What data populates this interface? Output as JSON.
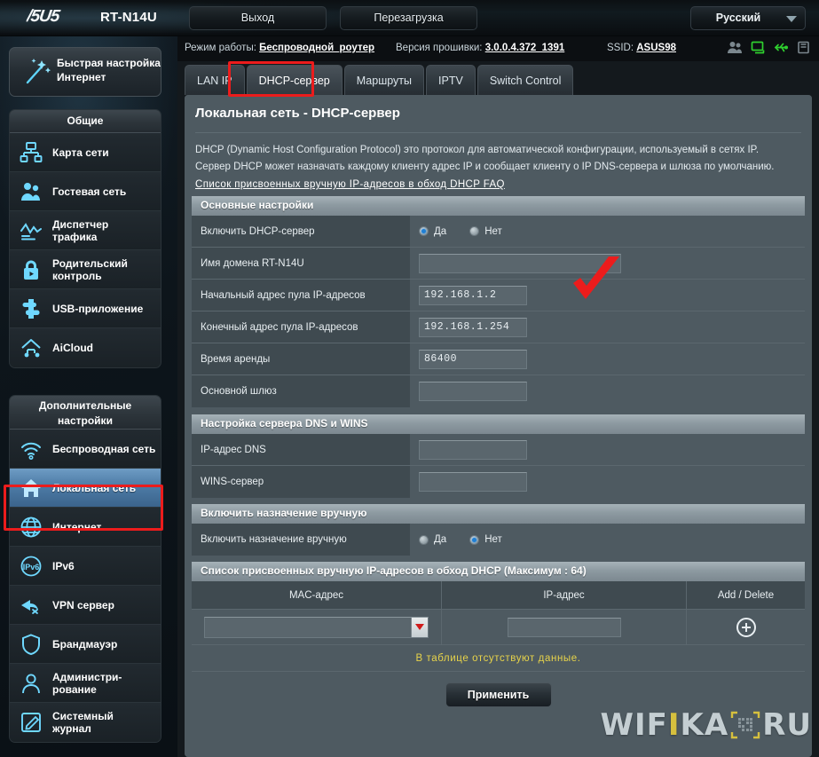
{
  "topbar": {
    "brand": "/5U5",
    "model": "RT-N14U",
    "logout_label": "Выход",
    "reboot_label": "Перезагрузка",
    "language": "Русский",
    "caret_icon": "chevron-down-icon"
  },
  "statusline": {
    "mode_label": "Режим работы:",
    "mode_value": "Беспроводной_роутер",
    "firmware_label": "Версия прошивки:",
    "firmware_value": "3.0.0.4.372_1391",
    "ssid_label": "SSID:",
    "ssid_value": "ASUS98",
    "icons": [
      {
        "name": "users-icon",
        "color": "#7b878e"
      },
      {
        "name": "lan-monitor-icon",
        "color": "#2fd02f"
      },
      {
        "name": "usb-icon",
        "color": "#2fd02f"
      },
      {
        "name": "printer-icon",
        "color": "#7b878e"
      }
    ]
  },
  "quick_setup": {
    "line1": "Быстрая настройка",
    "line2": "Интернет",
    "icon": "magic-wand-icon"
  },
  "sidebar": {
    "groups": [
      {
        "title": "Общие",
        "items": [
          {
            "label": "Карта сети",
            "icon": "network-map-icon",
            "active": false
          },
          {
            "label": "Гостевая сеть",
            "icon": "guest-network-icon",
            "active": false
          },
          {
            "label": "Диспетчер трафика",
            "icon": "traffic-manager-icon",
            "active": false
          },
          {
            "label": "Родительский контроль",
            "icon": "parental-lock-icon",
            "active": false
          },
          {
            "label": "USB-приложение",
            "icon": "usb-application-icon",
            "active": false
          },
          {
            "label": "AiCloud",
            "icon": "aicloud-icon",
            "active": false
          }
        ]
      },
      {
        "title": "Дополнительные настройки",
        "items": [
          {
            "label": "Беспроводная сеть",
            "icon": "wifi-icon",
            "active": false
          },
          {
            "label": "Локальная сеть",
            "icon": "home-lan-icon",
            "active": true
          },
          {
            "label": "Интернет",
            "icon": "globe-icon",
            "active": false
          },
          {
            "label": "IPv6",
            "icon": "ipv6-icon",
            "active": false
          },
          {
            "label": "VPN сервер",
            "icon": "vpn-icon",
            "active": false
          },
          {
            "label": "Брандмауэр",
            "icon": "shield-icon",
            "active": false
          },
          {
            "label": "Администри-рование",
            "icon": "admin-user-icon",
            "active": false
          },
          {
            "label": "Системный журнал",
            "icon": "system-log-icon",
            "active": false
          }
        ]
      }
    ]
  },
  "tabs": [
    {
      "label": "LAN IP",
      "selected": false
    },
    {
      "label": "DHCP-сервер",
      "selected": true
    },
    {
      "label": "Маршруты",
      "selected": false
    },
    {
      "label": "IPTV",
      "selected": false
    },
    {
      "label": "Switch Control",
      "selected": false
    }
  ],
  "page": {
    "title": "Локальная сеть - DHCP-сервер",
    "desc_line1": "DHCP (Dynamic Host Configuration Protocol) это протокол для автоматической конфигурации, используемый в сетях IP.",
    "desc_line2": "Сервер DHCP может назначать каждому клиенту адрес IP и сообщает клиенту о IP DNS-сервера и шлюза по умолчанию.",
    "faq_link": "Список присвоенных вручную IP-адресов в обход DHCP FAQ"
  },
  "sections": {
    "basic": {
      "title": "Основные настройки",
      "rows": [
        {
          "label": "Включить DHCP-сервер",
          "type": "radio",
          "yes_label": "Да",
          "no_label": "Нет",
          "value": "yes"
        },
        {
          "label": "Имя домена RT-N14U",
          "type": "input",
          "value": "",
          "width": "wide"
        },
        {
          "label": "Начальный адрес пула IP-адресов",
          "type": "input",
          "value": "192.168.1.2",
          "width": "med"
        },
        {
          "label": "Конечный адрес пула IP-адресов",
          "type": "input",
          "value": "192.168.1.254",
          "width": "med"
        },
        {
          "label": "Время аренды",
          "type": "input",
          "value": "86400",
          "width": "med"
        },
        {
          "label": "Основной шлюз",
          "type": "input",
          "value": "",
          "width": "med"
        }
      ]
    },
    "dns": {
      "title": "Настройка сервера DNS и WINS",
      "rows": [
        {
          "label": "IP-адрес DNS",
          "type": "input",
          "value": "",
          "width": "med"
        },
        {
          "label": "WINS-сервер",
          "type": "input",
          "value": "",
          "width": "med"
        }
      ]
    },
    "manual": {
      "title": "Включить назначение вручную",
      "rows": [
        {
          "label": "Включить назначение вручную",
          "type": "radio",
          "yes_label": "Да",
          "no_label": "Нет",
          "value": "no"
        }
      ]
    },
    "list": {
      "title": "Список присвоенных вручную IP-адресов в обход DHCP (Максимум : 64)",
      "columns": [
        "MAC-адрес",
        "IP-адрес",
        "Add / Delete"
      ],
      "input_row": {
        "mac_value": "",
        "ip_value": "",
        "add_icon": "plus-circle-icon"
      },
      "empty_message": "В таблице отсутствуют данные."
    }
  },
  "footer": {
    "apply_label": "Применить"
  },
  "watermark": {
    "part1": "WIF",
    "dot": "I",
    "part2": "KA",
    "qr": "qr-code-icon",
    "part3": "RU"
  },
  "annotations": {
    "red_cursor": "red-check-cursor",
    "red_highlight_tab": "DHCP-сервер",
    "red_highlight_menu": "Локальная сеть"
  },
  "colors": {
    "accent_red": "#ec1c1c",
    "active_blue": "#4d7ba6",
    "status_green": "#2fd02f",
    "warning_yellow": "#e7d34a"
  }
}
